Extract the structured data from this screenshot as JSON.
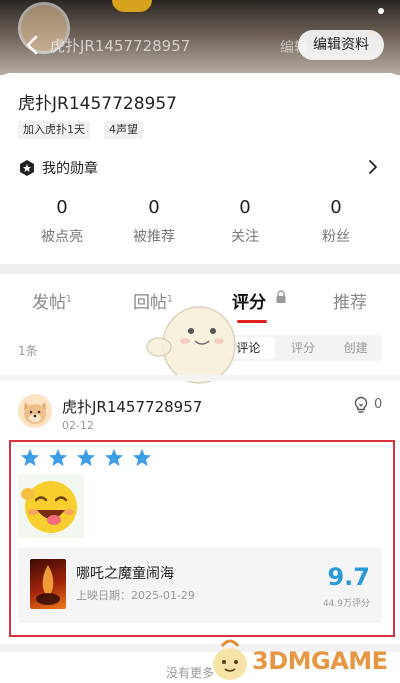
{
  "header": {
    "title_ghost": "虎扑JR1457728957",
    "edit_ghost": "编辑",
    "edit_button": "编辑资料"
  },
  "profile": {
    "username": "虎扑JR1457728957",
    "tags": [
      "加入虎扑1天",
      "4声望"
    ],
    "medal_label": "我的勋章",
    "stats": [
      {
        "value": "0",
        "label": "被点亮"
      },
      {
        "value": "0",
        "label": "被推荐"
      },
      {
        "value": "0",
        "label": "关注"
      },
      {
        "value": "0",
        "label": "粉丝"
      }
    ]
  },
  "tabs": [
    {
      "label": "发帖",
      "badge": "1"
    },
    {
      "label": "回帖",
      "badge": "1"
    },
    {
      "label": "评分",
      "badge": ""
    },
    {
      "label": "推荐",
      "badge": ""
    }
  ],
  "list": {
    "count": "1条",
    "segments": [
      "评论",
      "评分",
      "创建"
    ],
    "selected_segment": "评论"
  },
  "post": {
    "user": "虎扑JR1457728957",
    "date": "02-12",
    "likes": "0",
    "rating_stars": 5,
    "movie": {
      "title": "哪吒之魔童闹海",
      "release": "上映日期：2025-01-29",
      "score": "9.7",
      "rating_count": "44.9万评分"
    }
  },
  "footer": {
    "no_more": "没有更多",
    "watermark": "3DMGAME"
  },
  "colors": {
    "accent_red": "#e02020",
    "star_blue": "#3b9ee6",
    "score_blue": "#2a9bd8",
    "highlight_red": "#d9323a"
  }
}
